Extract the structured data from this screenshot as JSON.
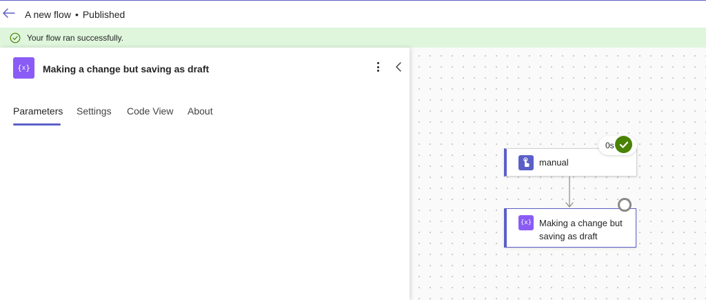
{
  "header": {
    "flow_name": "A new flow",
    "separator": "•",
    "status": "Published",
    "back_icon": "back-arrow-icon"
  },
  "banner": {
    "message": "Your flow ran successfully.",
    "icon": "success-check-circle-icon",
    "color": "#dff6dd"
  },
  "panel": {
    "title": "Making a change but saving as draft",
    "icon": "variable-braces-icon",
    "tabs": [
      {
        "label": "Parameters",
        "active": true
      },
      {
        "label": "Settings",
        "active": false
      },
      {
        "label": "Code View",
        "active": false
      },
      {
        "label": "About",
        "active": false
      }
    ]
  },
  "canvas": {
    "nodes": [
      {
        "label": "manual",
        "icon": "touch-trigger-icon",
        "duration": "0s",
        "status": "succeeded"
      },
      {
        "label": "Making a change but saving as draft",
        "icon": "variable-braces-icon",
        "status": "not-run"
      }
    ]
  },
  "colors": {
    "accent": "#5b5fc7",
    "action_purple": "#8a5cf5",
    "success_green": "#498205"
  }
}
